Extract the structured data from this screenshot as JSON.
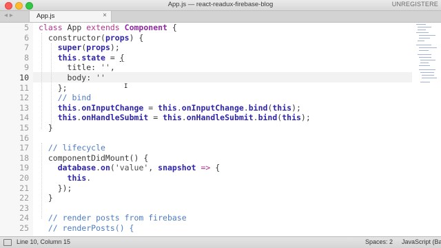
{
  "window": {
    "title": "App.js — react-readux-firebase-blog",
    "unregistered": "UNREGISTERE"
  },
  "tabs": [
    {
      "label": "App.js",
      "close": "×"
    }
  ],
  "nav": {
    "back": "◂",
    "forward": "▸"
  },
  "editor": {
    "line_numbers": [
      "5",
      "6",
      "7",
      "8",
      "9",
      "10",
      "11",
      "12",
      "13",
      "14",
      "15",
      "16",
      "17",
      "18",
      "19",
      "20",
      "21",
      "22",
      "23",
      "24",
      "25"
    ],
    "active_line": "10",
    "cursor_glyph": "I"
  },
  "status": {
    "position": "Line 10, Column 15",
    "spaces": "Spaces: 2",
    "syntax": "JavaScript (Bab"
  },
  "colors": {
    "keyword": "#b3338e",
    "this_keyword": "#2d24a8",
    "class_name": "#8d2aa0",
    "comment": "#4d7bc2"
  }
}
